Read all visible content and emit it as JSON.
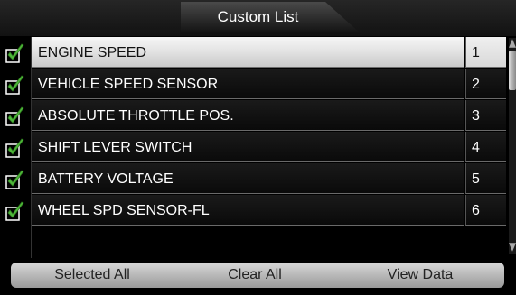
{
  "header": {
    "title": "Custom List"
  },
  "list": {
    "items": [
      {
        "label": "ENGINE SPEED",
        "num": "1",
        "checked": true,
        "selected": true
      },
      {
        "label": "VEHICLE SPEED SENSOR",
        "num": "2",
        "checked": true,
        "selected": false
      },
      {
        "label": "ABSOLUTE THROTTLE POS.",
        "num": "3",
        "checked": true,
        "selected": false
      },
      {
        "label": "SHIFT LEVER SWITCH",
        "num": "4",
        "checked": true,
        "selected": false
      },
      {
        "label": "BATTERY VOLTAGE",
        "num": "5",
        "checked": true,
        "selected": false
      },
      {
        "label": "WHEEL SPD SENSOR-FL",
        "num": "6",
        "checked": true,
        "selected": false
      }
    ]
  },
  "footer": {
    "select_all_label": "Selected  All",
    "clear_all_label": "Clear  All",
    "view_data_label": "View Data"
  },
  "colors": {
    "check": "#4fb83a",
    "selected_row": "#e6e6e6",
    "background": "#000000"
  }
}
